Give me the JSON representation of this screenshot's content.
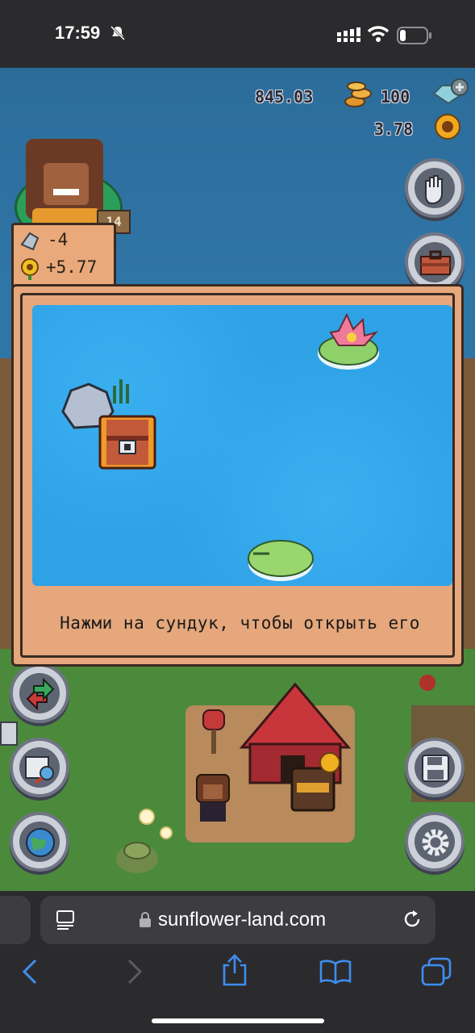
{
  "status_bar": {
    "time": "17:59"
  },
  "hud": {
    "coins": "845.03",
    "gems": "100",
    "sunflowers": "3.78",
    "level": "14"
  },
  "inventory_delta": {
    "stone": "-4",
    "sunflower": "+5.77"
  },
  "modal": {
    "message": "Нажми на сундук, чтобы открыть его"
  },
  "browser": {
    "url": "sunflower-land.com"
  },
  "icons": {
    "colors": {
      "water": "#2fa2e6",
      "panel": "#e5a77b",
      "grass": "#4b8a3b"
    }
  }
}
